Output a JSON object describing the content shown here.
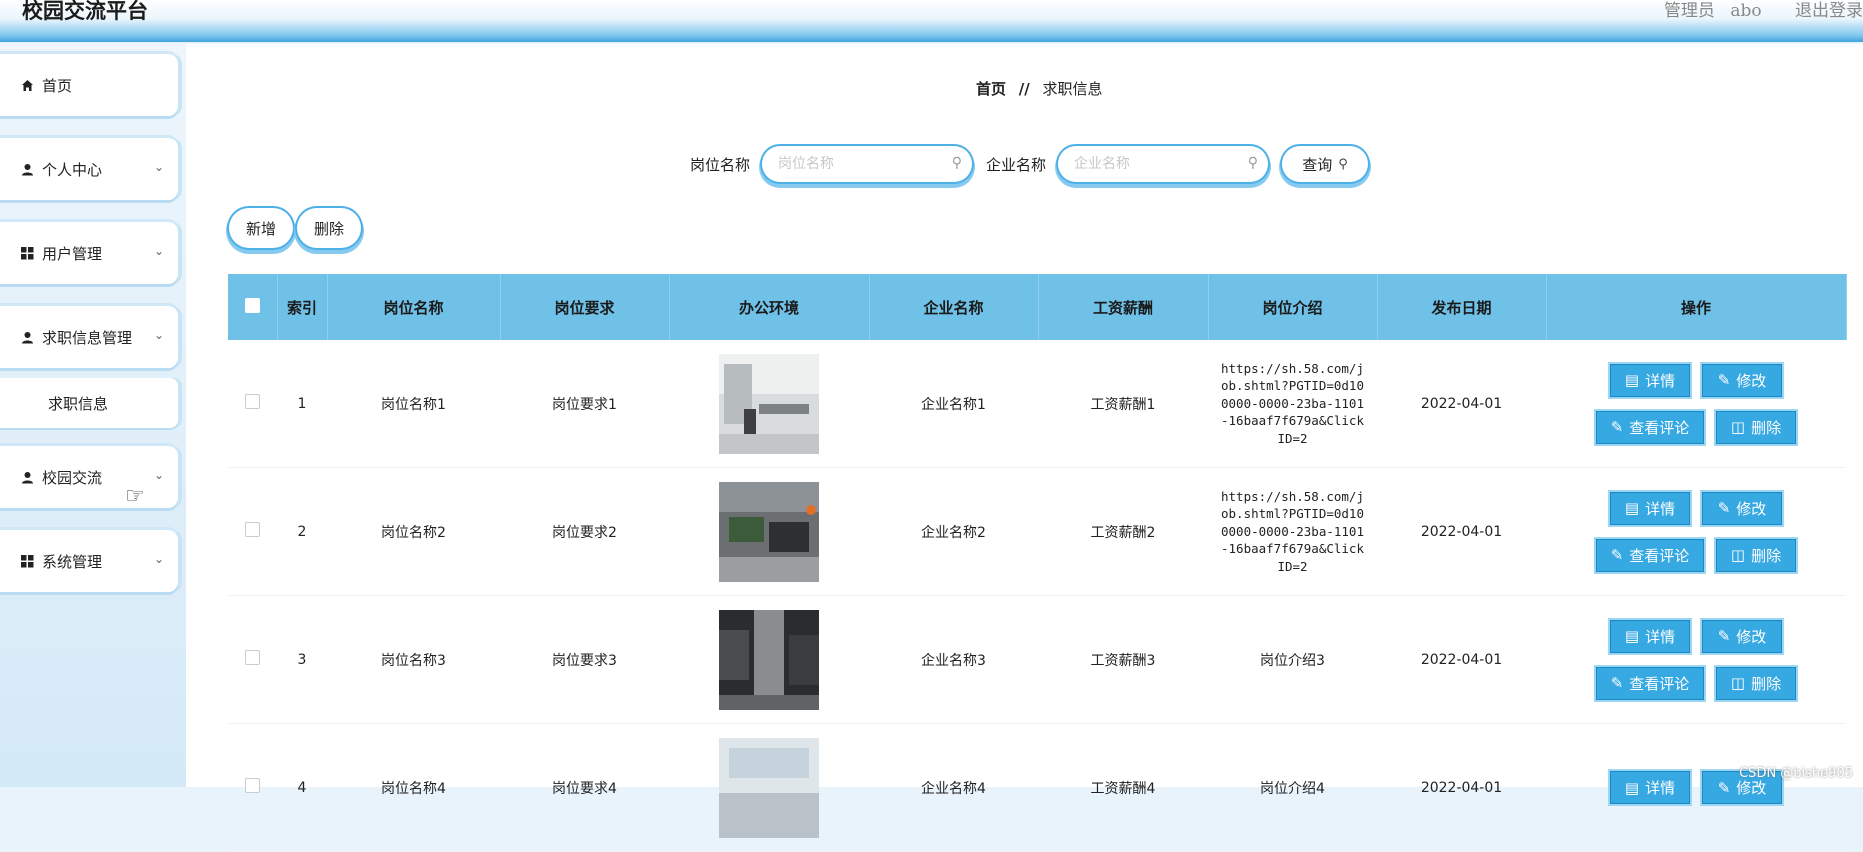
{
  "app": {
    "title": "校园交流平台",
    "user_role": "管理员",
    "user_name": "abo",
    "logout": "退出登录"
  },
  "sidebar": {
    "items": [
      {
        "label": "首页",
        "icon": "home-icon"
      },
      {
        "label": "个人中心",
        "icon": "user-icon"
      },
      {
        "label": "用户管理",
        "icon": "grid-icon"
      },
      {
        "label": "求职信息管理",
        "icon": "user-icon"
      },
      {
        "label": "求职信息",
        "icon": ""
      },
      {
        "label": "校园交流",
        "icon": "user-icon"
      },
      {
        "label": "系统管理",
        "icon": "grid-icon"
      }
    ]
  },
  "breadcrumb": {
    "home": "首页",
    "sep": "//",
    "current": "求职信息"
  },
  "search": {
    "job_label": "岗位名称",
    "job_placeholder": "岗位名称",
    "company_label": "企业名称",
    "company_placeholder": "企业名称",
    "query_button": "查询"
  },
  "actions": {
    "add": "新增",
    "delete": "删除"
  },
  "table": {
    "headers": [
      "索引",
      "岗位名称",
      "岗位要求",
      "办公环境",
      "企业名称",
      "工资薪酬",
      "岗位介绍",
      "发布日期",
      "操作"
    ],
    "rows": [
      {
        "index": "1",
        "job": "岗位名称1",
        "req": "岗位要求1",
        "company": "企业名称1",
        "salary": "工资薪酬1",
        "intro": "https://sh.58.com/job.shtml?PGTID=0d100000-0000-23ba-1101-16baaf7f679a&ClickID=2",
        "date": "2022-04-01"
      },
      {
        "index": "2",
        "job": "岗位名称2",
        "req": "岗位要求2",
        "company": "企业名称2",
        "salary": "工资薪酬2",
        "intro": "https://sh.58.com/job.shtml?PGTID=0d100000-0000-23ba-1101-16baaf7f679a&ClickID=2",
        "date": "2022-04-01"
      },
      {
        "index": "3",
        "job": "岗位名称3",
        "req": "岗位要求3",
        "company": "企业名称3",
        "salary": "工资薪酬3",
        "intro": "岗位介绍3",
        "date": "2022-04-01"
      },
      {
        "index": "4",
        "job": "岗位名称4",
        "req": "岗位要求4",
        "company": "企业名称4",
        "salary": "工资薪酬4",
        "intro": "岗位介绍4",
        "date": "2022-04-01"
      }
    ],
    "ops": {
      "detail": "详情",
      "edit": "修改",
      "comments": "查看评论",
      "delete": "删除"
    }
  },
  "watermark": "CSDN @bishe905",
  "colors": {
    "header_bg": "#6fc1e8",
    "button_bg": "#36a8e2",
    "accent_border": "#4db0e6"
  }
}
